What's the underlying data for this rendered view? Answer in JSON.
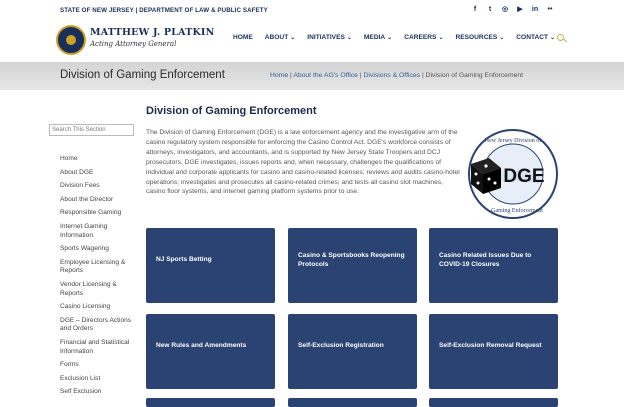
{
  "topbar": {
    "state_label": "STATE OF NEW JERSEY | DEPARTMENT OF LAW & PUBLIC SAFETY",
    "social": [
      "f",
      "t",
      "◎",
      "▶",
      "in",
      "••"
    ]
  },
  "header": {
    "ag_name": "MATTHEW J. PLATKIN",
    "ag_title": "Acting Attorney General",
    "nav": [
      {
        "label": "HOME",
        "caret": ""
      },
      {
        "label": "ABOUT",
        "caret": "⌄"
      },
      {
        "label": "INITIATIVES",
        "caret": "⌄"
      },
      {
        "label": "MEDIA",
        "caret": "⌄"
      },
      {
        "label": "CAREERS",
        "caret": "⌄"
      },
      {
        "label": "RESOURCES",
        "caret": "⌄"
      },
      {
        "label": "CONTACT",
        "caret": "⌄"
      }
    ]
  },
  "band": {
    "title": "Division of Gaming Enforcement",
    "crumbs": [
      "Home",
      "About the AG's Office",
      "Divisions & Offices",
      "Division of Gaming Enforcement"
    ]
  },
  "sidebar": {
    "search_placeholder": "Search This Section",
    "items": [
      "Home",
      "About DGE",
      "Division Fees",
      "About the Director",
      "Responsible Gaming",
      "Internet Gaming Information",
      "Sports Wagering",
      "Employee Licensing & Reports",
      "Vendor Licensing & Reports",
      "Casino Licensing",
      "DGE – Directors Actions and Orders",
      "Financial and Statistical Information",
      "Forms",
      "Exclusion List",
      "Self Exclusion"
    ]
  },
  "main": {
    "title": "Division of Gaming Enforcement",
    "intro": "The Division of Gaming Enforcement (DGE) is a law enforcement agency and the investigative arm of the casino regulatory system responsible for enforcing the Casino Control Act. DGE's workforce consists of attorneys, investigators, and accountants, and is supported by New Jersey State Troopers and DCJ prosecutors. DGE investigates, issues reports and, when necessary, challenges the qualifications of individual and corporate applicants for casino and casino-related licenses; reviews and audits casino-hotel operations; investigates and prosecutes all casino-related crimes; and tests all casino slot machines, casino floor systems, and internet gaming platform systems prior to use.",
    "logo_text": {
      "top": "New Jersey Division of",
      "center": "DGE",
      "bottom": "Gaming Enforcement"
    }
  },
  "tiles": [
    {
      "label": "NJ Sports Betting"
    },
    {
      "label": "Casino & Sportsbooks Reopening Protocols"
    },
    {
      "label": "Casino Related Issues Due to COVID-19 Closures"
    },
    {
      "label": "New Rules and Amendments"
    },
    {
      "label": "Self-Exclusion Registration"
    },
    {
      "label": "Self-Exclusion Removal Request"
    }
  ],
  "colors": {
    "navy": "#1a2e5a",
    "tile": "#2a4373",
    "gold": "#c9a227",
    "link": "#2f5f9e"
  }
}
